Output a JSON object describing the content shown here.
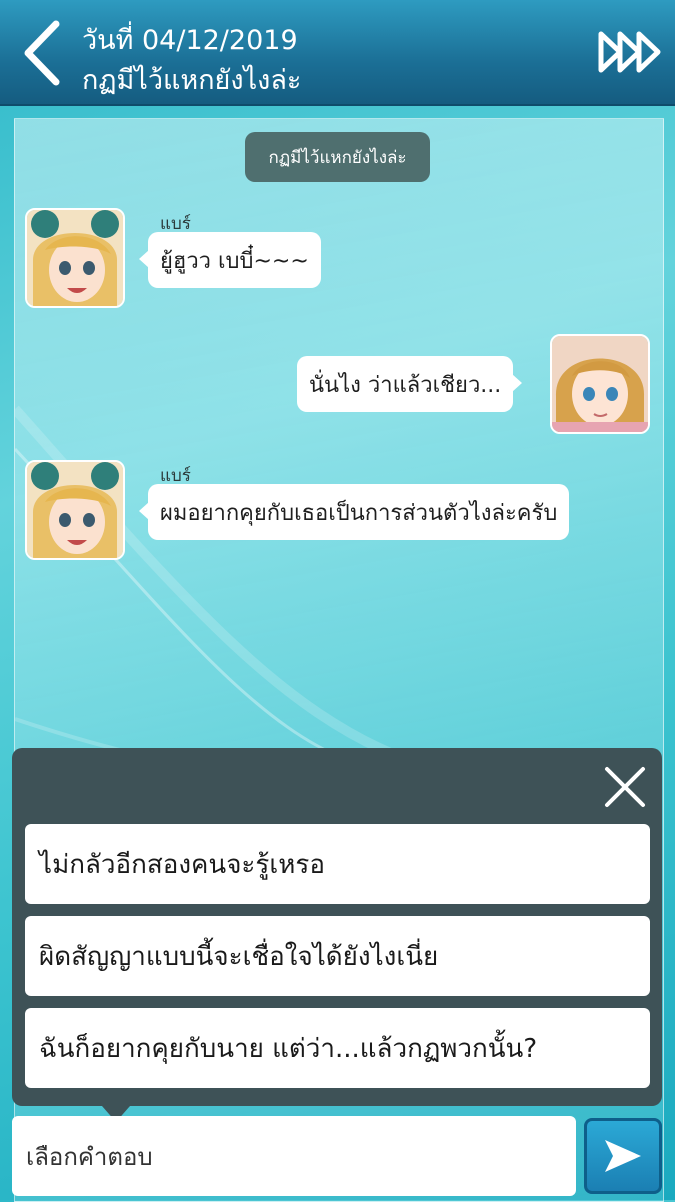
{
  "header": {
    "date": "วันที่ 04/12/2019",
    "title": "กฏมีไว้แหกยังไงล่ะ"
  },
  "chat": {
    "topic": "กฏมีไว้แหกยังไงล่ะ",
    "messages": [
      {
        "side": "left",
        "sender": "แบร์",
        "text": "ยู้ฮูวว เบบี๋~~~"
      },
      {
        "side": "right",
        "sender": "",
        "text": "นั่นไง ว่าแล้วเชียว..."
      },
      {
        "side": "left",
        "sender": "แบร์",
        "text": "ผมอยากคุยกับเธอเป็นการส่วนตัวไงล่ะครับ"
      }
    ]
  },
  "choices": [
    "ไม่กลัวอีกสองคนจะรู้เหรอ",
    "ผิดสัญญาแบบนี้จะเชื่อใจได้ยังไงเนี่ย",
    "ฉันก็อยากคุยกับนาย  แต่ว่า...แล้วกฏพวกนั้น?"
  ],
  "input": {
    "value": "เลือกคำตอบ"
  },
  "colors": {
    "header": "#1b6f96",
    "topic_pill": "#4f6f6f",
    "choice_panel": "#3e5257",
    "send_button": "#1b7fb3"
  },
  "icons": {
    "back": "back-chevron-icon",
    "skip": "fast-forward-icon",
    "close": "close-icon",
    "send": "send-arrow-icon"
  }
}
